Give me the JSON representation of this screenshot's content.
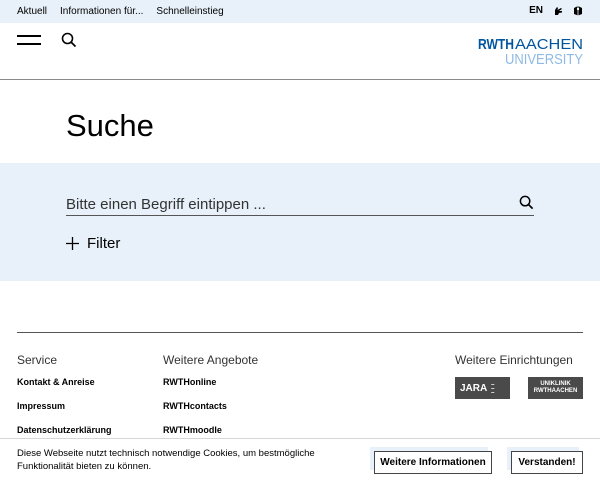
{
  "topbar": {
    "links": [
      "Aktuell",
      "Informationen für...",
      "Schnelleinstieg"
    ],
    "language": "EN"
  },
  "header": {
    "logo_line1_bold": "RWTH",
    "logo_line1": "AACHEN",
    "logo_line2": "UNIVERSITY"
  },
  "page": {
    "title": "Suche"
  },
  "search": {
    "placeholder": "Bitte einen Begriff eintippen ...",
    "value": "",
    "filter_label": "Filter"
  },
  "footer": {
    "service": {
      "heading": "Service",
      "links": [
        "Kontakt & Anreise",
        "Impressum",
        "Datenschutzerklärung"
      ]
    },
    "weitere_angebote": {
      "heading": "Weitere Angebote",
      "links": [
        "RWTHonline",
        "RWTHcontacts",
        "RWTHmoodle"
      ]
    },
    "weitere_einrichtungen": {
      "heading": "Weitere Einrichtungen",
      "jara": "JARA",
      "uniklinik_line1": "UNIKLINIK",
      "uniklinik_line2": "RWTHAACHEN"
    }
  },
  "cookie": {
    "text": "Diese Webseite nutzt technisch notwendige Cookies, um bestmögliche Funktionalität bieten zu können.",
    "more_label": "Weitere Informationen",
    "accept_label": "Verstanden!"
  },
  "colors": {
    "accent_blue": "#00549f",
    "panel_bg": "#e8f1fa"
  },
  "icons": {
    "search": "search-icon",
    "menu": "hamburger-menu-icon",
    "sign_language": "sign-language-icon",
    "easy_language": "easy-language-icon",
    "filter": "plus-icon"
  }
}
